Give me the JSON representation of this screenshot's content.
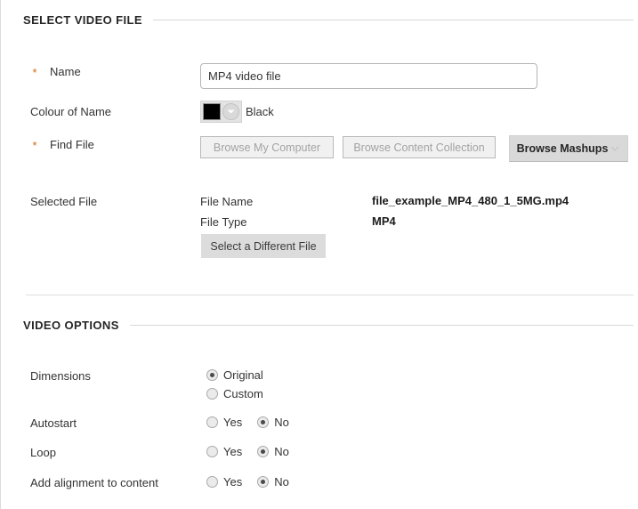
{
  "sections": {
    "select_video_file": {
      "title": "SELECT VIDEO FILE"
    },
    "video_options": {
      "title": "VIDEO OPTIONS"
    }
  },
  "fields": {
    "name": {
      "label": "Name",
      "required_marker": "*",
      "value": "MP4 video file",
      "placeholder": ""
    },
    "colour_of_name": {
      "label": "Colour of Name",
      "selected_color_name": "Black",
      "selected_color_hex": "#000000"
    },
    "find_file": {
      "label": "Find File",
      "required_marker": "*",
      "buttons": {
        "browse_my_computer": "Browse My Computer",
        "browse_content_collection": "Browse Content Collection",
        "browse_mashups": "Browse Mashups"
      }
    },
    "selected_file": {
      "label": "Selected File",
      "rows": [
        {
          "label": "File Name",
          "value": "file_example_MP4_480_1_5MG.mp4"
        },
        {
          "label": "File Type",
          "value": "MP4"
        }
      ],
      "change_button": "Select a Different File"
    }
  },
  "video_options": {
    "dimensions": {
      "label": "Dimensions",
      "options": [
        {
          "label": "Original",
          "selected": true
        },
        {
          "label": "Custom",
          "selected": false
        }
      ]
    },
    "autostart": {
      "label": "Autostart",
      "options": [
        {
          "label": "Yes",
          "selected": false
        },
        {
          "label": "No",
          "selected": true
        }
      ]
    },
    "loop": {
      "label": "Loop",
      "options": [
        {
          "label": "Yes",
          "selected": false
        },
        {
          "label": "No",
          "selected": true
        }
      ]
    },
    "add_alignment": {
      "label": "Add alignment to content",
      "options": [
        {
          "label": "Yes",
          "selected": false
        },
        {
          "label": "No",
          "selected": true
        }
      ]
    }
  },
  "colors": {
    "required_star": "#d4690f",
    "header_text": "#262626",
    "rule": "#d8d8d8"
  }
}
